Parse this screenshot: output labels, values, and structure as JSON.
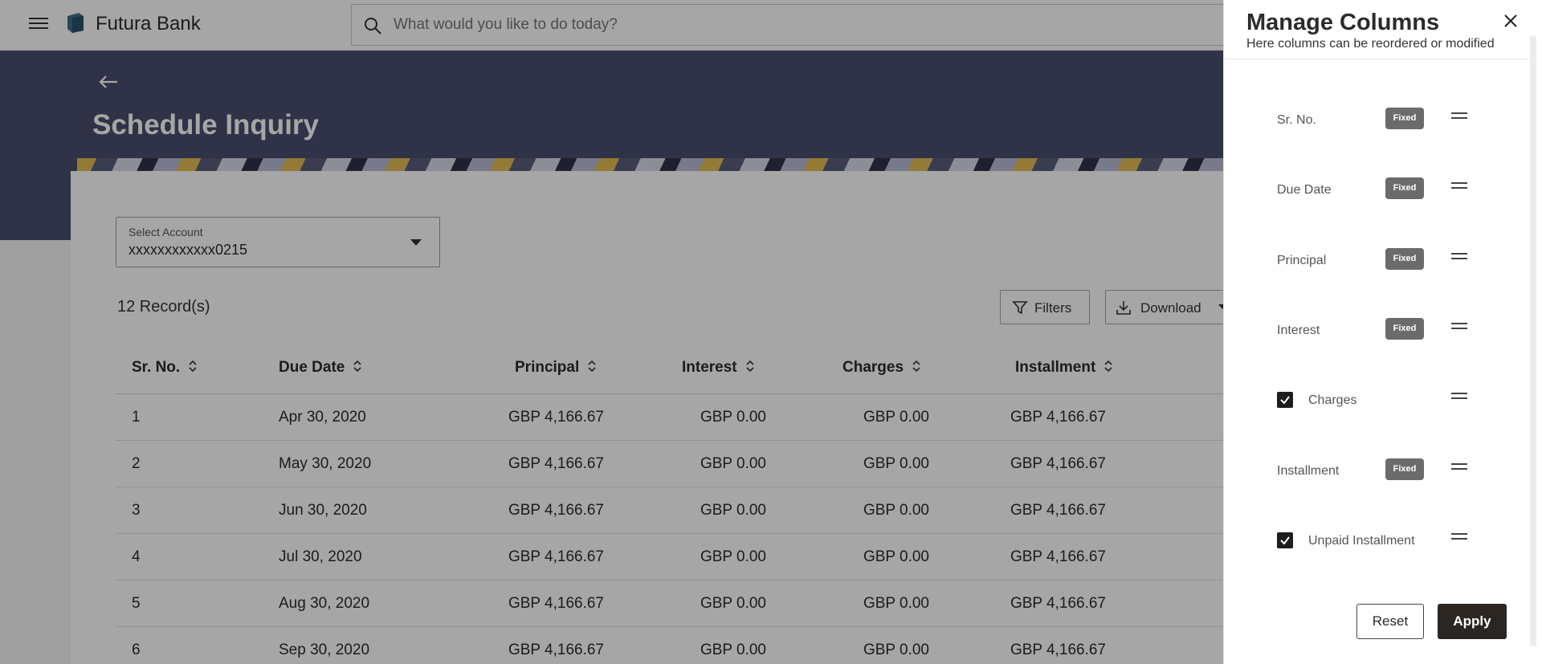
{
  "app": {
    "brand": "Futura Bank"
  },
  "search": {
    "placeholder": "What would you like to do today?"
  },
  "page": {
    "title": "Schedule Inquiry"
  },
  "account": {
    "label": "Select Account",
    "value": "xxxxxxxxxxxx0215"
  },
  "records": "12 Record(s)",
  "toolbar": {
    "filters_label": "Filters",
    "download_label": "Download"
  },
  "table": {
    "headers": [
      "Sr. No.",
      "Due Date",
      "Principal",
      "Interest",
      "Charges",
      "Installment"
    ],
    "rows": [
      [
        "1",
        "Apr 30, 2020",
        "GBP 4,166.67",
        "GBP 0.00",
        "GBP 0.00",
        "GBP 4,166.67"
      ],
      [
        "2",
        "May 30, 2020",
        "GBP 4,166.67",
        "GBP 0.00",
        "GBP 0.00",
        "GBP 4,166.67"
      ],
      [
        "3",
        "Jun 30, 2020",
        "GBP 4,166.67",
        "GBP 0.00",
        "GBP 0.00",
        "GBP 4,166.67"
      ],
      [
        "4",
        "Jul 30, 2020",
        "GBP 4,166.67",
        "GBP 0.00",
        "GBP 0.00",
        "GBP 4,166.67"
      ],
      [
        "5",
        "Aug 30, 2020",
        "GBP 4,166.67",
        "GBP 0.00",
        "GBP 0.00",
        "GBP 4,166.67"
      ],
      [
        "6",
        "Sep 30, 2020",
        "GBP 4,166.67",
        "GBP 0.00",
        "GBP 0.00",
        "GBP 4,166.67"
      ]
    ]
  },
  "panel": {
    "title": "Manage Columns",
    "subtitle": "Here columns can be reordered or modified",
    "columns": [
      {
        "label": "Sr. No.",
        "fixed": true,
        "badge": "Fixed"
      },
      {
        "label": "Due Date",
        "fixed": true,
        "badge": "Fixed"
      },
      {
        "label": "Principal",
        "fixed": true,
        "badge": "Fixed"
      },
      {
        "label": "Interest",
        "fixed": true,
        "badge": "Fixed"
      },
      {
        "label": "Charges",
        "fixed": false,
        "checked": true
      },
      {
        "label": "Installment",
        "fixed": true,
        "badge": "Fixed"
      },
      {
        "label": "Unpaid Installment",
        "fixed": false,
        "checked": true
      }
    ],
    "reset_label": "Reset",
    "apply_label": "Apply"
  },
  "colors": {
    "header_band": "#4a4f6d",
    "apply_button": "#2b2622",
    "fixed_badge": "#6b6b6b"
  },
  "icons": [
    "menu-icon",
    "bank-logo-icon",
    "search-icon",
    "back-arrow-icon",
    "filter-icon",
    "download-icon",
    "caret-down-icon",
    "sort-icon",
    "close-icon",
    "drag-handle-icon",
    "checkbox-checked-icon"
  ]
}
